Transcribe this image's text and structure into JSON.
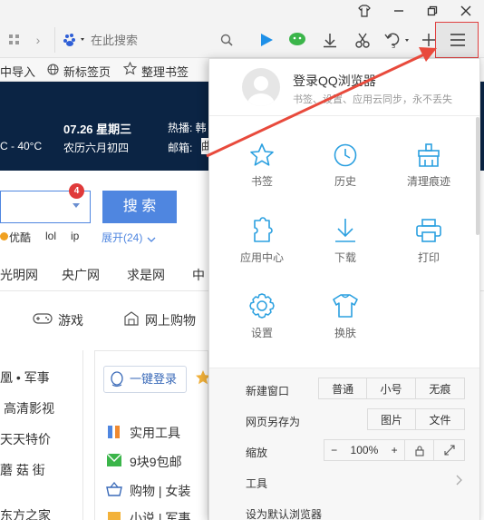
{
  "titlebar": {
    "icons": [
      "shirt-icon",
      "minimize-icon",
      "restore-icon",
      "close-icon"
    ]
  },
  "toolbar": {
    "search_placeholder": "在此搜索"
  },
  "bookmarks": {
    "items": [
      "中导入",
      "新标签页",
      "整理书签"
    ]
  },
  "hero": {
    "temperature": "C - 40°C",
    "date": "07.26 星期三",
    "lunar": "农历六月初四",
    "hot_label": "热播: 韩",
    "mail_label": "邮箱:",
    "mail_value": "曲"
  },
  "search": {
    "badge": "4",
    "button": "搜 索",
    "hot_links": [
      "优酷",
      "lol",
      "ip"
    ],
    "expand": "展开(24)"
  },
  "nav": {
    "items": [
      "光明网",
      "央广网",
      "求是网",
      "中"
    ]
  },
  "categories": {
    "items": [
      "游戏",
      "网上购物"
    ]
  },
  "left_list": {
    "items": [
      "凰 • 军事",
      "高清影视",
      "天天特价",
      "蘑 菇 街",
      "东方之家"
    ]
  },
  "login": {
    "button": "一键登录"
  },
  "mid_list": {
    "items": [
      "实用工具",
      "9块9包邮",
      "购物 | 女装",
      "小说 | 军事"
    ]
  },
  "menu": {
    "user": {
      "title": "登录QQ浏览器",
      "subtitle": "书签、设置、应用云同步，永不丢失"
    },
    "grid": [
      {
        "label": "书签",
        "icon": "star-icon"
      },
      {
        "label": "历史",
        "icon": "clock-icon"
      },
      {
        "label": "清理痕迹",
        "icon": "broom-icon"
      },
      {
        "label": "应用中心",
        "icon": "puzzle-icon"
      },
      {
        "label": "下载",
        "icon": "download-icon"
      },
      {
        "label": "打印",
        "icon": "printer-icon"
      },
      {
        "label": "设置",
        "icon": "gear-icon"
      },
      {
        "label": "换肤",
        "icon": "tshirt-icon"
      }
    ],
    "new_window": {
      "label": "新建窗口",
      "options": [
        "普通",
        "小号",
        "无痕"
      ]
    },
    "save_as": {
      "label": "网页另存为",
      "options": [
        "图片",
        "文件"
      ]
    },
    "zoom": {
      "label": "缩放",
      "minus": "−",
      "value": "100%",
      "plus": "+"
    },
    "tools": {
      "label": "工具"
    },
    "default_browser": {
      "label": "设为默认浏览器"
    }
  },
  "colors": {
    "accent": "#2ba0e0",
    "search_button": "#4f86e0",
    "hero_bg": "#0b2444",
    "arrow": "#e84a3c"
  }
}
